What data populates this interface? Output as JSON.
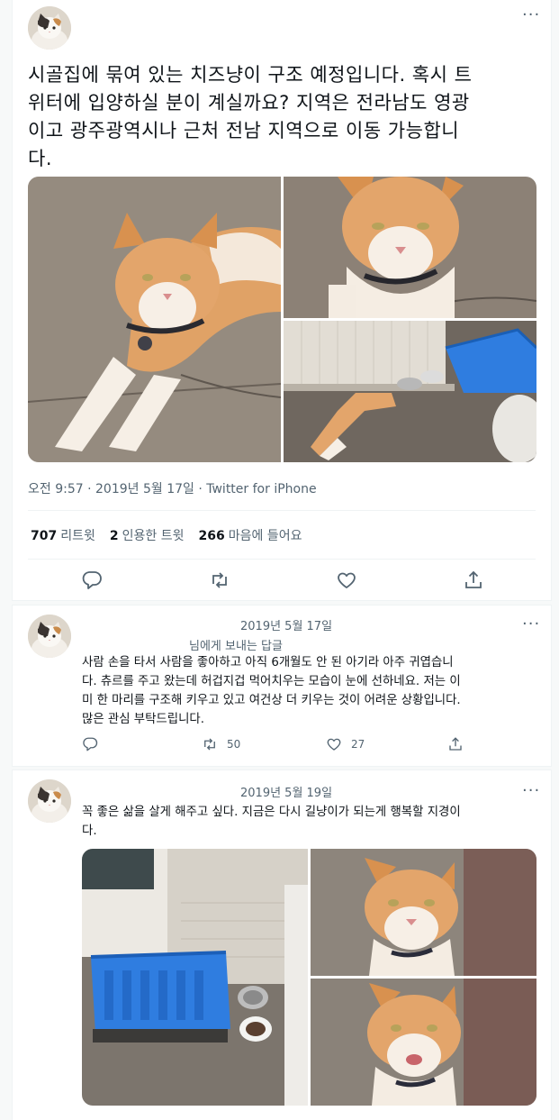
{
  "main_tweet": {
    "text": "시골집에 묶여 있는 치즈냥이 구조 예정입니다. 혹시 트위터에 입양하실 분이 계실까요? 지역은 전라남도 영광이고 광주광역시나 근처 전남 지역으로 이동 가능합니다.",
    "line1": "시골집에 묶여 있는 치즈냥이 구조 예정입니다. 혹시 트",
    "line2": "위터에 입양하실 분이 계실까요? 지역은 전라남도 영광",
    "line3": "이고 광주광역시나 근처 전남 지역으로 이동 가능합니",
    "line4": "다.",
    "timestamp": "오전 9:57 · 2019년 5월 17일 · Twitter for iPhone",
    "retweets": "707",
    "retweets_label": "리트윗",
    "quotes": "2",
    "quotes_label": "인용한 트윗",
    "likes": "266",
    "likes_label": "마음에 들어요"
  },
  "reply1": {
    "date": "2019년 5월 17일",
    "reply_to": "님에게 보내는 답글",
    "line1": "사람 손을 타서 사람을 좋아하고 아직 6개월도 안 된 아기라 아주 귀엽습니",
    "line2": "다. 츄르를 주고 왔는데 허겁지겁 먹어치우는 모습이 눈에 선하네요. 저는 이",
    "line3": "미 한 마리를 구조해 키우고 있고 여건상 더 키우는 것이 어려운 상황입니다.",
    "line4": "많은 관심 부탁드립니다.",
    "retweets": "50",
    "likes": "27"
  },
  "reply2": {
    "date": "2019년 5월 19일",
    "line1": "꼭 좋은 삶을 살게 해주고 싶다. 지금은 다시 길냥이가 되는게 행복할 지경이",
    "line2": "다."
  },
  "colors": {
    "secondary_text": "#536471",
    "border": "#eff3f4",
    "cat_orange": "#e0a266",
    "crate_blue": "#2f7de0"
  },
  "icons": [
    "more-icon",
    "reply-icon",
    "retweet-icon",
    "like-icon",
    "share-icon"
  ]
}
